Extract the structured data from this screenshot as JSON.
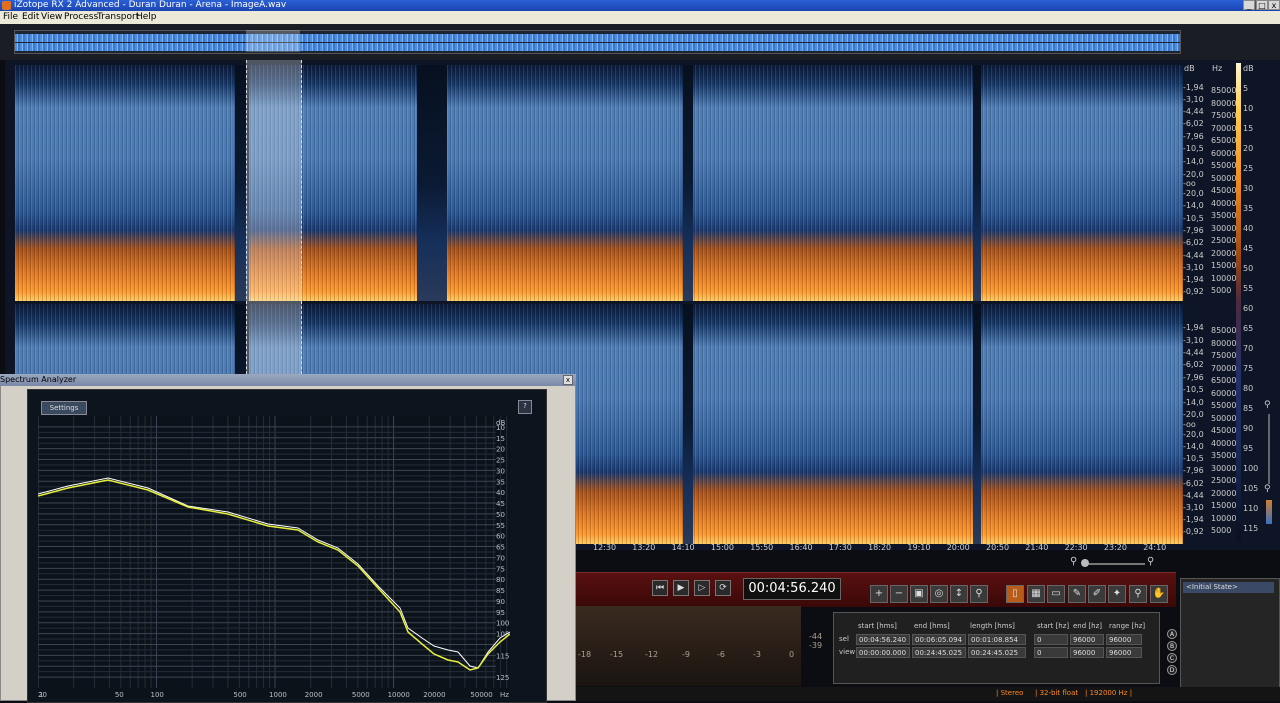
{
  "window": {
    "title": "iZotope RX 2 Advanced - Duran Duran - Arena - ImageA.wav"
  },
  "menu": [
    "File",
    "Edit",
    "View",
    "Process",
    "Transport",
    "Help"
  ],
  "spectrogram": {
    "db_unit": "dB",
    "hz_unit": "Hz",
    "db_labels": [
      "-1,94",
      "-3,10",
      "-4,44",
      "-6,02",
      "-7,96",
      "-10,5",
      "-14,0",
      "-20,0",
      "-oo",
      "-20,0",
      "-14,0",
      "-10,5",
      "-7,96",
      "-6,02",
      "-4,44",
      "-3,10",
      "-1,94",
      "-0,92"
    ],
    "hz_labels": [
      "85000",
      "80000",
      "75000",
      "70000",
      "65000",
      "60000",
      "55000",
      "50000",
      "45000",
      "40000",
      "35000",
      "30000",
      "25000",
      "20000",
      "15000",
      "10000",
      "5000"
    ],
    "color_labels": [
      "dB",
      "5",
      "10",
      "15",
      "20",
      "25",
      "30",
      "35",
      "40",
      "45",
      "50",
      "55",
      "60",
      "65",
      "70",
      "75",
      "80",
      "85",
      "90",
      "95",
      "100",
      "105",
      "110",
      "115"
    ],
    "time_labels": [
      "12:30",
      "13:20",
      "14:10",
      "15:00",
      "15:50",
      "16:40",
      "17:30",
      "18:20",
      "19:10",
      "20:00",
      "20:50",
      "21:40",
      "22:30",
      "23:20",
      "24:10"
    ]
  },
  "transport": {
    "timecode": "00:04:56.240"
  },
  "meter": {
    "labels": [
      "-18",
      "-15",
      "-12",
      "-9",
      "-6",
      "-3",
      "0"
    ],
    "peak": [
      "-44",
      "-39"
    ]
  },
  "selection": {
    "headers": [
      "start [hms]",
      "end [hms]",
      "length [hms]",
      "start [hz]",
      "end [hz]",
      "range [hz]"
    ],
    "rows": [
      {
        "label": "sel",
        "values": [
          "00:04:56.240",
          "00:06:05.094",
          "00:01:08.854",
          "0",
          "96000",
          "96000"
        ]
      },
      {
        "label": "view",
        "values": [
          "00:00:00.000",
          "00:24:45.025",
          "00:24:45.025",
          "0",
          "96000",
          "96000"
        ]
      }
    ],
    "slots": [
      "A",
      "B",
      "C",
      "D"
    ]
  },
  "history": {
    "items": [
      "<Initial State>"
    ]
  },
  "status": {
    "channels": "Stereo",
    "bitdepth": "32-bit float",
    "rate": "192000 Hz"
  },
  "spectrum_analyzer": {
    "title": "Spectrum Analyzer",
    "settings_label": "Settings",
    "help_label": "?",
    "close_label": "x",
    "db_unit": "dB",
    "hz_unit": "Hz",
    "db_ticks": [
      10,
      15,
      20,
      25,
      30,
      35,
      40,
      45,
      50,
      55,
      60,
      65,
      70,
      75,
      80,
      85,
      90,
      95,
      100,
      105,
      115,
      125
    ],
    "hz_ticks": [
      "20",
      "50",
      "100",
      "500",
      "1000",
      "2000",
      "5000",
      "10000",
      "20000",
      "50000"
    ],
    "hz_tick_first": "1",
    "curve_colors": {
      "primary": "#e6ef3a",
      "secondary": "#ffffff"
    }
  }
}
